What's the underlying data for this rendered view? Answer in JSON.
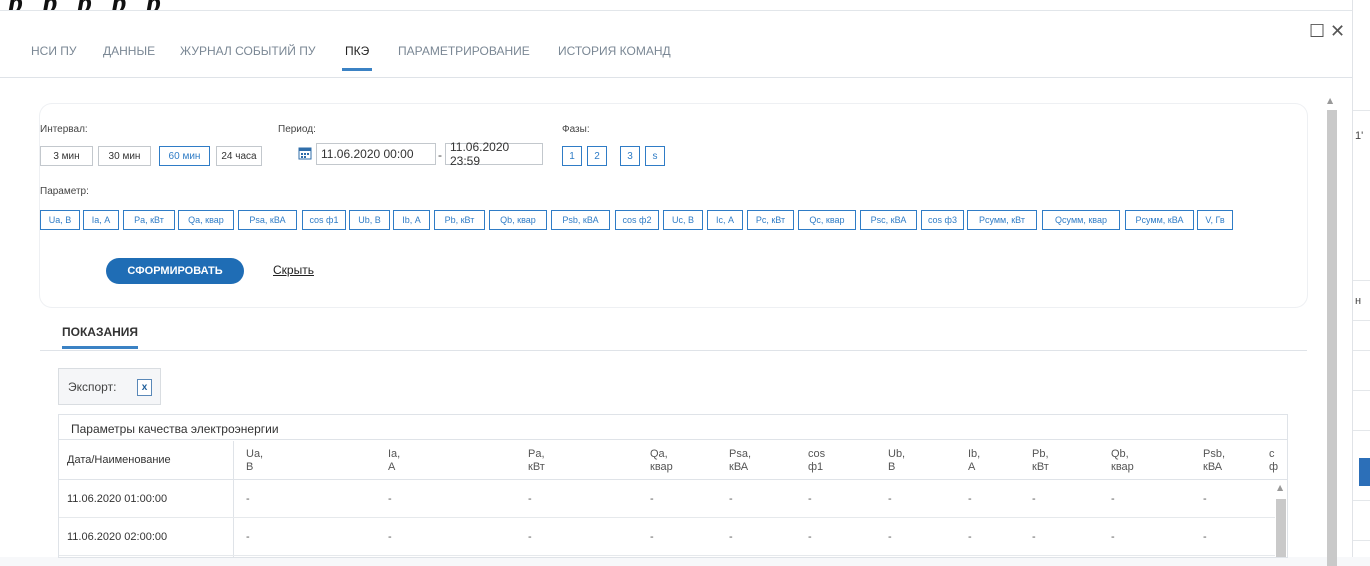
{
  "background": {
    "title_fragment": "р р р р р"
  },
  "window": {
    "maximize_glyph": "☐",
    "close_glyph": "✕"
  },
  "tabs": [
    {
      "label": "НСИ ПУ"
    },
    {
      "label": "ДАННЫЕ"
    },
    {
      "label": "ЖУРНАЛ СОБЫТИЙ ПУ"
    },
    {
      "label": "ПКЭ",
      "active": true
    },
    {
      "label": "ПАРАМЕТРИРОВАНИЕ"
    },
    {
      "label": "ИСТОРИЯ КОМАНД"
    }
  ],
  "filter": {
    "interval_label": "Интервал:",
    "intervals": [
      {
        "label": "3 мин"
      },
      {
        "label": "30 мин"
      },
      {
        "label": "60 мин",
        "selected": true
      },
      {
        "label": "24 часа"
      }
    ],
    "period_label": "Период:",
    "period_from": "11.06.2020 00:00",
    "period_sep": "-",
    "period_to": "11.06.2020 23:59",
    "phases_label": "Фазы:",
    "phases": [
      "1",
      "2",
      "3",
      "s"
    ],
    "param_label": "Параметр:",
    "params": [
      "Ua, В",
      "Ia, А",
      "Pa, кВт",
      "Qa, квар",
      "Psa, кВА",
      "cos ф1",
      "Ub, В",
      "Ib, А",
      "Pb, кВт",
      "Qb, квар",
      "Psb, кВА",
      "cos ф2",
      "Uc, В",
      "Ic, А",
      "Pc, кВт",
      "Qc, квар",
      "Psc, кВА",
      "cos ф3",
      "Pсумм, кВт",
      "Qсумм, квар",
      "Pсумм, кВА",
      "V, Гв"
    ],
    "submit_label": "СФОРМИРОВАТЬ",
    "hide_label": "Скрыть"
  },
  "readings": {
    "tab_label": "ПОКАЗАНИЯ",
    "export_label": "Экспорт:",
    "export_icon": "excel-file-icon",
    "grid_title": "Параметры качества электроэнергии",
    "columns": [
      {
        "name": "Дата/Наименование",
        "unit": ""
      },
      {
        "name": "Ua,",
        "unit": "В"
      },
      {
        "name": "Ia,",
        "unit": "А"
      },
      {
        "name": "Pa,",
        "unit": "кВт"
      },
      {
        "name": "Qa,",
        "unit": "квар"
      },
      {
        "name": "Psa,",
        "unit": "кВА"
      },
      {
        "name": "cos",
        "unit": "ф1"
      },
      {
        "name": "Ub,",
        "unit": "В"
      },
      {
        "name": "Ib,",
        "unit": "А"
      },
      {
        "name": "Pb,",
        "unit": "кВт"
      },
      {
        "name": "Qb,",
        "unit": "квар"
      },
      {
        "name": "Psb,",
        "unit": "кВА"
      },
      {
        "name": "c",
        "unit": "ф"
      }
    ],
    "rows": [
      {
        "date": "11.06.2020 01:00:00",
        "values": [
          "-",
          "-",
          "-",
          "-",
          "-",
          "-",
          "-",
          "-",
          "-",
          "-",
          "-"
        ]
      },
      {
        "date": "11.06.2020 02:00:00",
        "values": [
          "-",
          "-",
          "-",
          "-",
          "-",
          "-",
          "-",
          "-",
          "-",
          "-",
          "-"
        ]
      }
    ]
  },
  "right_strip": {
    "mark_top": "1'",
    "mark_mid": "н"
  }
}
